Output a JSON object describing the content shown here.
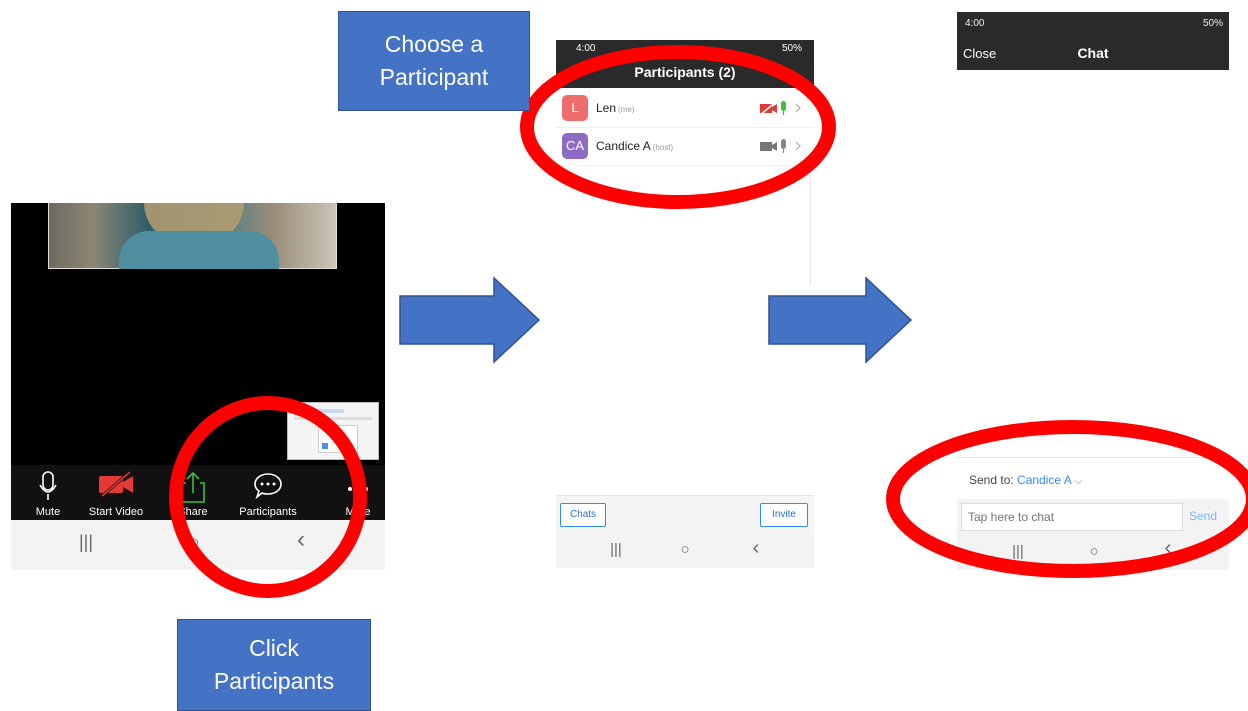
{
  "callouts": {
    "choose": [
      "Choose a",
      "Participant"
    ],
    "click": [
      "Click",
      "Participants"
    ]
  },
  "meeting": {
    "toolbar": [
      {
        "label": "Mute",
        "icon": "microphone-icon"
      },
      {
        "label": "Start Video",
        "icon": "video-off-icon"
      },
      {
        "label": "Share",
        "icon": "share-icon"
      },
      {
        "label": "Participants",
        "icon": "participants-chat-icon"
      },
      {
        "label": "More",
        "icon": "more-icon"
      }
    ]
  },
  "participants_screen": {
    "status_time": "4:00",
    "status_battery": "50%",
    "title": "Participants (2)",
    "participants": [
      {
        "initials": "L",
        "name": "Len",
        "tag": "(me)",
        "color": "#f06c6c",
        "video": "off"
      },
      {
        "initials": "CA",
        "name": "Candice A",
        "tag": "(host)",
        "color": "#8e6cc5",
        "video": "on"
      }
    ],
    "chats_button": "Chats",
    "invite_button": "Invite"
  },
  "chat_screen": {
    "status_time": "4:00",
    "status_battery": "50%",
    "close_label": "Close",
    "title": "Chat",
    "send_to_label": "Send to:",
    "send_to_value": "Candice A",
    "input_placeholder": "Tap here to chat",
    "send_label": "Send"
  },
  "nav": {
    "recents": "|||",
    "home": "○",
    "back": "‹"
  },
  "colors": {
    "callout": "#4472c4",
    "arrow": "#4472c4",
    "highlight_ring": "#ff0000",
    "zoom_blue": "#2d8cff"
  }
}
